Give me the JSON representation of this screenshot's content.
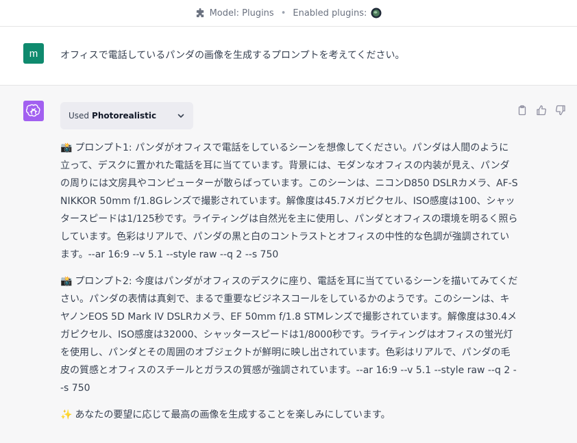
{
  "topbar": {
    "model_label": "Model: Plugins",
    "separator": "•",
    "enabled_label": "Enabled plugins:",
    "puzzle_icon": "puzzle-icon",
    "plugin_icon": "plugin-globe-icon"
  },
  "user_message": {
    "avatar_letter": "m",
    "avatar_color": "#0f8a6e",
    "text": "オフィスで電話しているパンダの画像を生成するプロンプトを考えてください。"
  },
  "assistant_message": {
    "avatar_color": "#a260f0",
    "plugin_chip": {
      "used_label": "Used",
      "plugin_name": "Photorealistic"
    },
    "actions": [
      "clipboard-icon",
      "thumbs-up-icon",
      "thumbs-down-icon"
    ],
    "paragraphs": [
      {
        "emoji": "📸",
        "text": "プロンプト1: パンダがオフィスで電話をしているシーンを想像してください。パンダは人間のように立って、デスクに置かれた電話を耳に当てています。背景には、モダンなオフィスの内装が見え、パンダの周りには文房具やコンピューターが散らばっています。このシーンは、ニコンD850 DSLRカメラ、AF-S NIKKOR 50mm f/1.8Gレンズで撮影されています。解像度は45.7メガピクセル、ISO感度は100、シャッタースピードは1/125秒です。ライティングは自然光を主に使用し、パンダとオフィスの環境を明るく照らしています。色彩はリアルで、パンダの黒と白のコントラストとオフィスの中性的な色調が強調されています。--ar 16:9 --v 5.1 --style raw --q 2 --s 750"
      },
      {
        "emoji": "📸",
        "text": "プロンプト2: 今度はパンダがオフィスのデスクに座り、電話を耳に当てているシーンを描いてみてください。パンダの表情は真剣で、まるで重要なビジネスコールをしているかのようです。このシーンは、キヤノンEOS 5D Mark IV DSLRカメラ、EF 50mm f/1.8 STMレンズで撮影されています。解像度は30.4メガピクセル、ISO感度は32000、シャッタースピードは1/8000秒です。ライティングはオフィスの蛍光灯を使用し、パンダとその周囲のオブジェクトが鮮明に映し出されています。色彩はリアルで、パンダの毛皮の質感とオフィスのスチールとガラスの質感が強調されています。--ar 16:9 --v 5.1 --style raw --q 2 --s 750"
      },
      {
        "emoji": "✨",
        "text": "あなたの要望に応じて最高の画像を生成することを楽しみにしています。"
      }
    ]
  }
}
